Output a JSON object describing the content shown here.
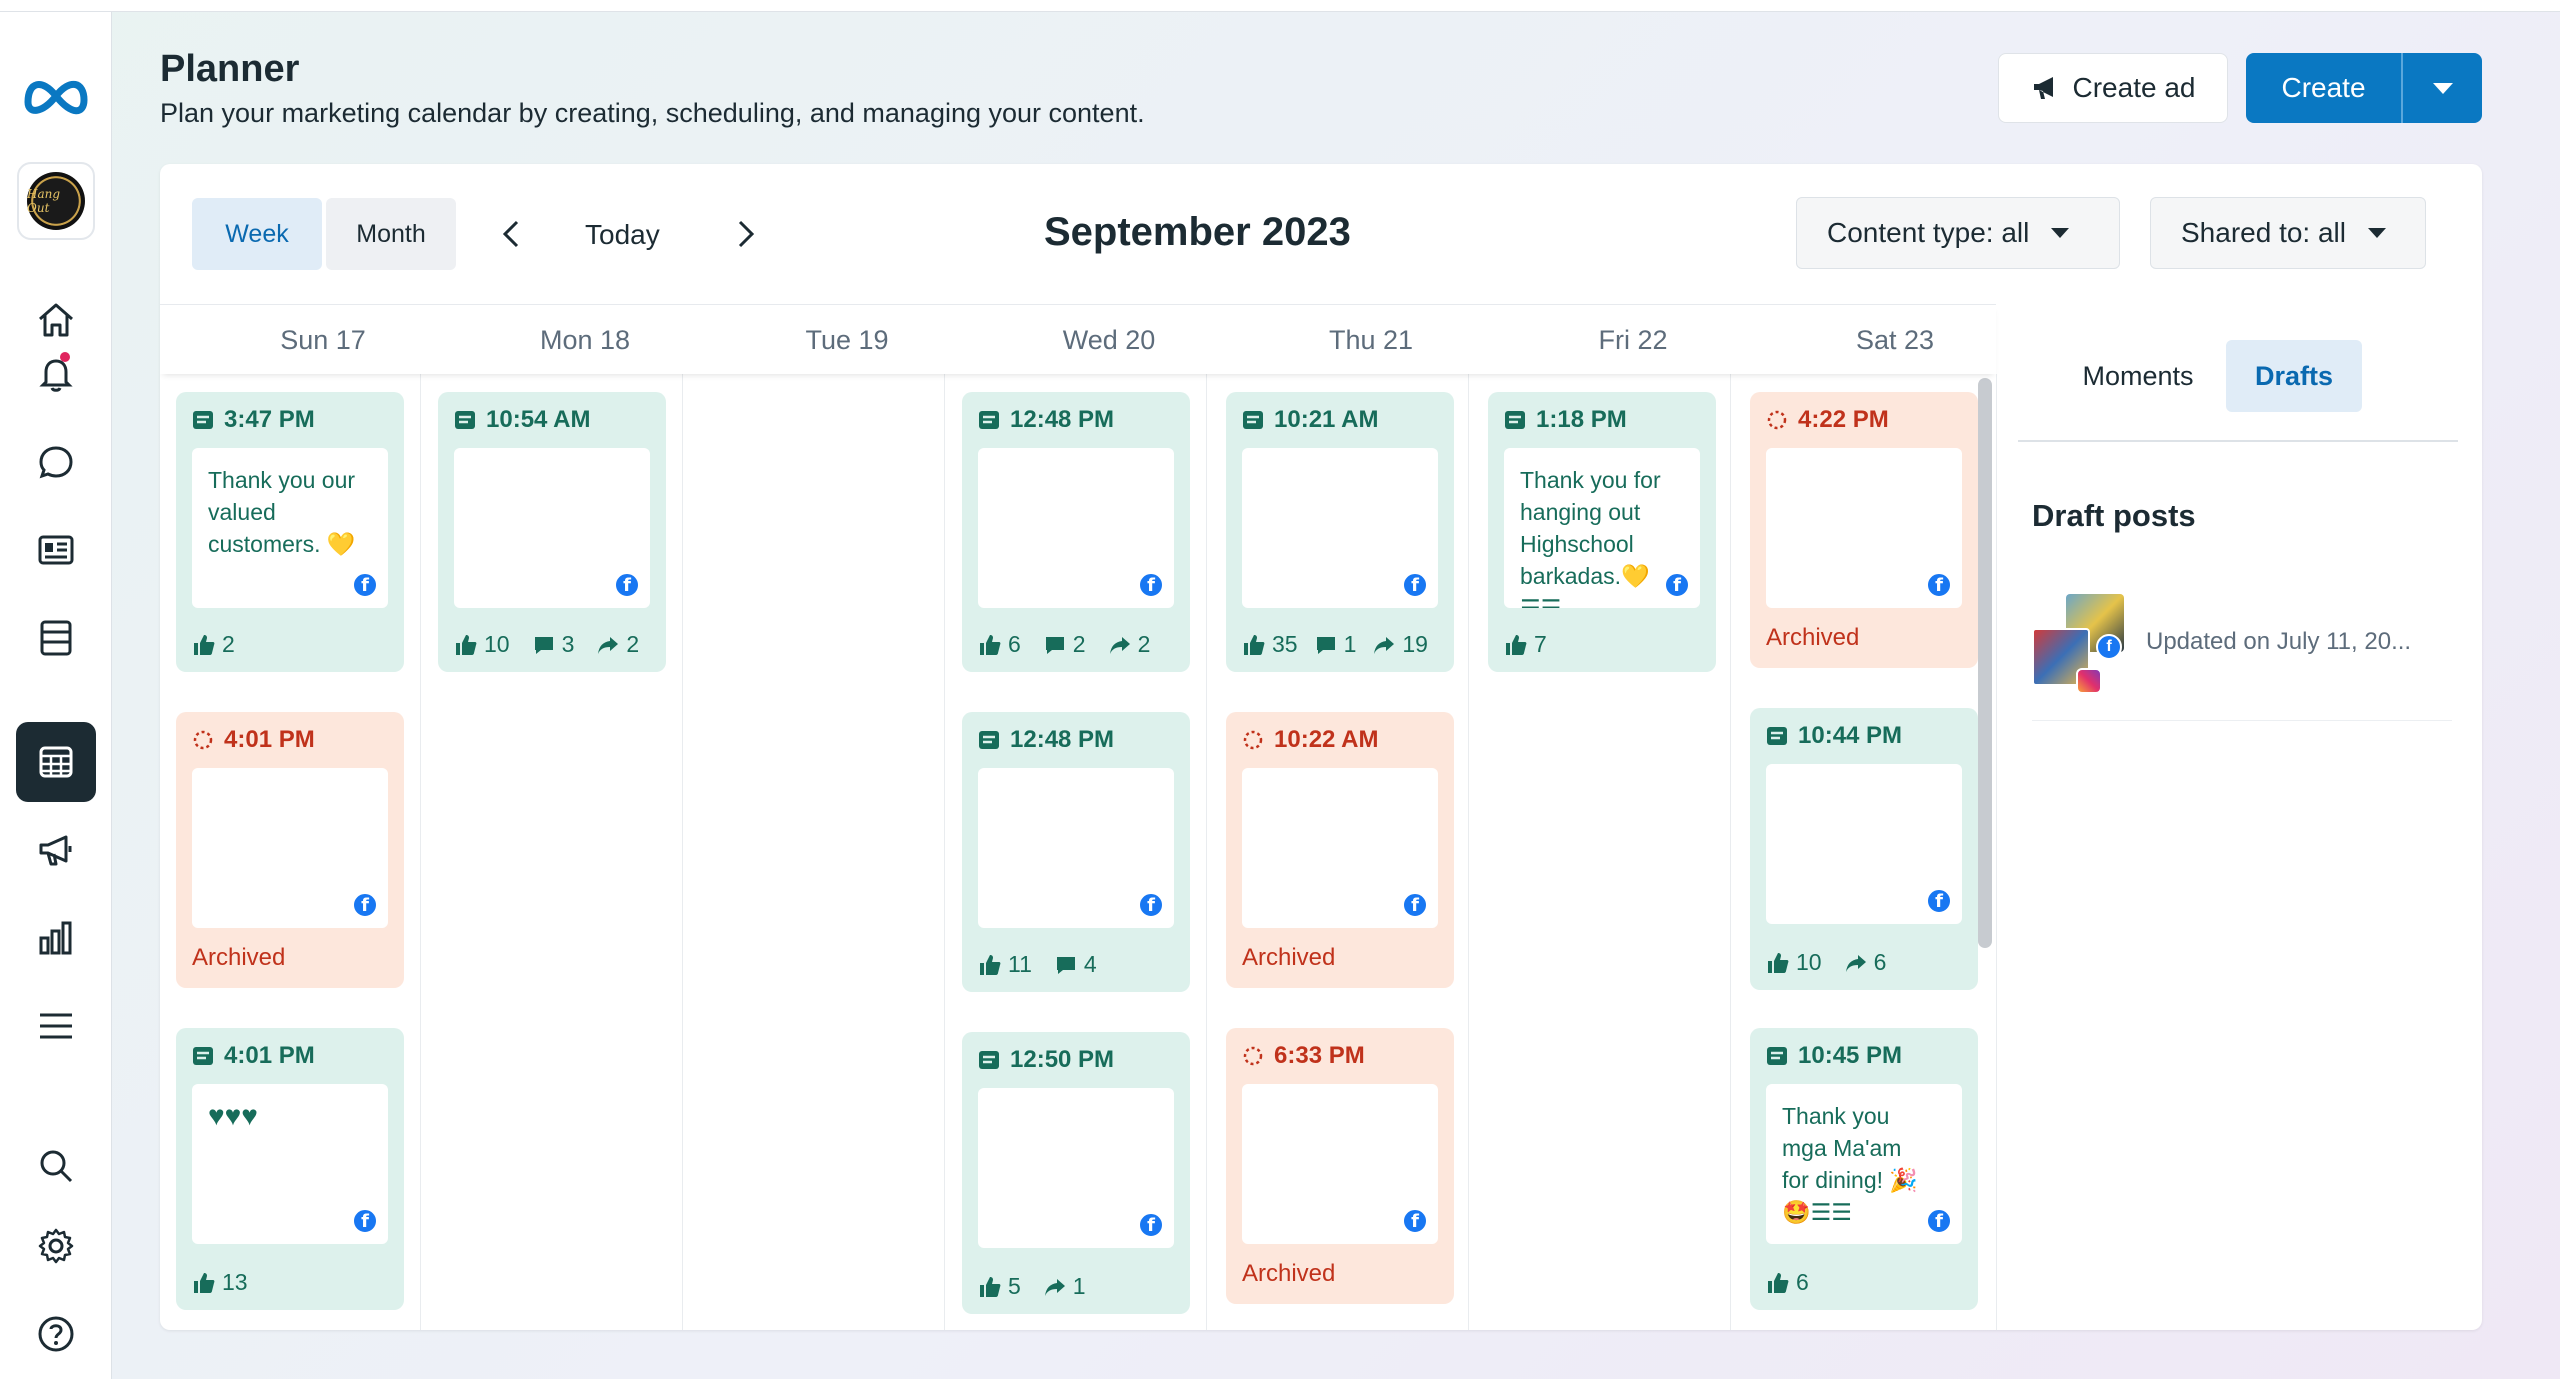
{
  "header": {
    "title": "Planner",
    "subtitle": "Plan your marketing calendar by creating, scheduling, and managing your content.",
    "create_ad_label": "Create ad",
    "create_label": "Create"
  },
  "rail": {
    "items": [
      "home-icon",
      "notifications-icon",
      "inbox-icon",
      "content-icon",
      "posts-icon",
      "planner-icon",
      "ads-icon",
      "insights-icon",
      "menu-icon",
      "search-icon",
      "settings-icon",
      "help-icon"
    ],
    "active": "planner-icon",
    "avatar_text": "Hang Out"
  },
  "toolbar": {
    "view_week": "Week",
    "view_month": "Month",
    "selected_view": "Week",
    "today_label": "Today",
    "month_title": "September 2023",
    "content_type": "Content type: all",
    "shared_to": "Shared to: all"
  },
  "days": [
    "Sun 17",
    "Mon 18",
    "Tue 19",
    "Wed 20",
    "Thu 21",
    "Fri 22",
    "Sat 23"
  ],
  "posts": {
    "sun_1": {
      "time": "3:47 PM",
      "text": "Thank you our valued customers. 💛",
      "likes": "2"
    },
    "sun_2": {
      "time": "4:01 PM",
      "status": "Archived"
    },
    "sun_3": {
      "time": "4:01 PM",
      "text": "♥♥♥",
      "likes": "13"
    },
    "mon_1": {
      "time": "10:54 AM",
      "likes": "10",
      "comments": "3",
      "shares": "2"
    },
    "wed_1": {
      "time": "12:48 PM",
      "likes": "6",
      "comments": "2",
      "shares": "2"
    },
    "wed_2": {
      "time": "12:48 PM",
      "likes": "11",
      "comments": "4"
    },
    "wed_3": {
      "time": "12:50 PM",
      "likes": "5",
      "shares": "1"
    },
    "thu_1": {
      "time": "10:21 AM",
      "likes": "35",
      "comments": "1",
      "shares": "19"
    },
    "thu_2": {
      "time": "10:22 AM",
      "status": "Archived"
    },
    "thu_3": {
      "time": "6:33 PM",
      "status": "Archived"
    },
    "fri_1": {
      "time": "1:18 PM",
      "text": "Thank you for hanging out Highschool barkadas.💛 ☰☰",
      "likes": "7"
    },
    "sat_1": {
      "time": "4:22 PM",
      "status": "Archived"
    },
    "sat_2": {
      "time": "10:44 PM",
      "likes": "10",
      "shares": "6"
    },
    "sat_3": {
      "time": "10:45 PM",
      "text": "Thank you mga Ma'am for dining! 🎉 🤩☰☰",
      "likes": "6"
    }
  },
  "drafts_panel": {
    "tab_moments": "Moments",
    "tab_drafts": "Drafts",
    "selected_tab": "Drafts",
    "title": "Draft posts",
    "items": [
      {
        "updated": "Updated on July 11, 20..."
      }
    ]
  },
  "colors": {
    "brand_blue": "#0a78c2",
    "published_bg": "#ddf1ec",
    "published_text": "#176c5a",
    "archived_bg": "#fde7dc",
    "archived_text": "#c0321b"
  }
}
